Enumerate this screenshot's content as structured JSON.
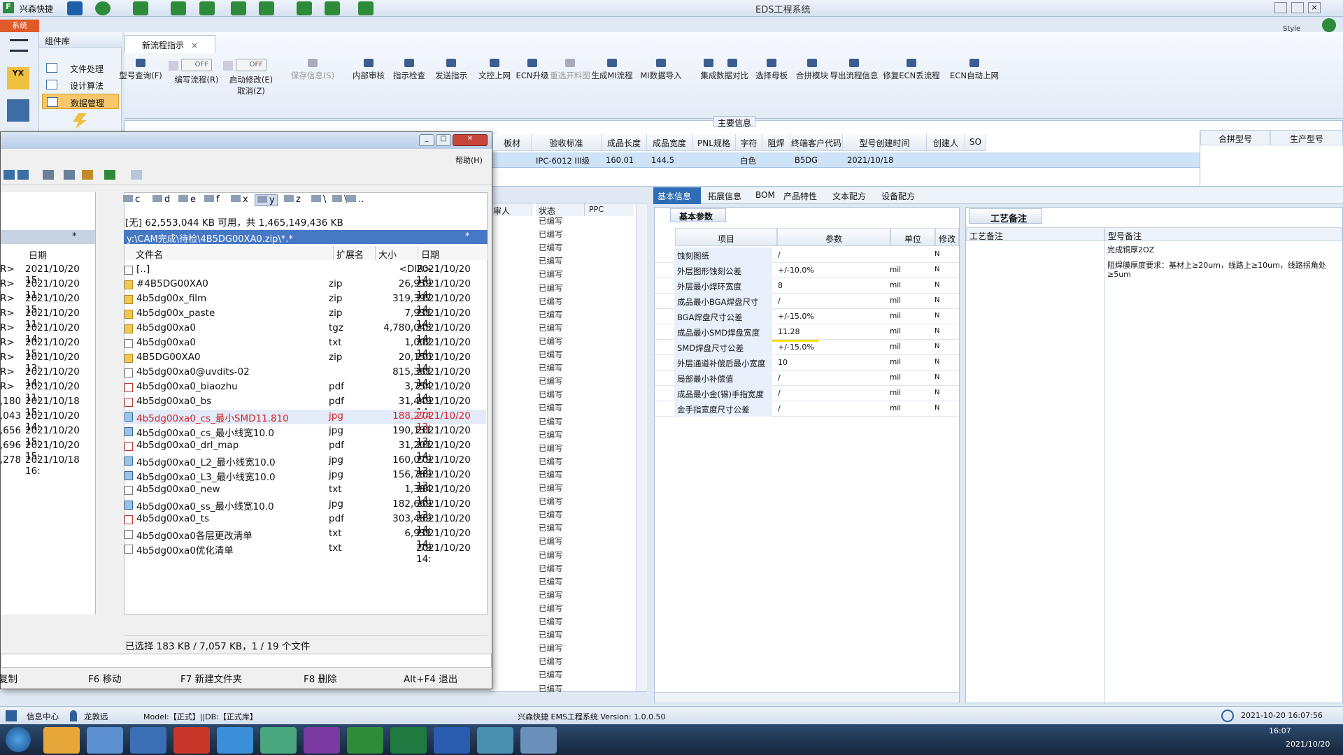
{
  "app": {
    "name": "兴森快捷",
    "title": "EDS工程系统",
    "style_label": "Style"
  },
  "sys_button": "系统",
  "component_lib": {
    "title": "组件库",
    "items": [
      "文件处理",
      "设计算法",
      "数据管理"
    ]
  },
  "flow_tab": "新流程指示",
  "ribbon": {
    "buttons": [
      {
        "label": "型号查询(F)",
        "x": 0
      },
      {
        "label": "编写流程(R)",
        "x": 1,
        "toggle": "OFF"
      },
      {
        "label": "启动修改(E)",
        "x": 2,
        "toggle": "OFF",
        "sub": "取消(Z)"
      },
      {
        "label": "保存信息(S)",
        "x": 3,
        "disabled": true
      },
      {
        "label": "内部审核",
        "x": 4
      },
      {
        "label": "指示检查",
        "x": 5
      },
      {
        "label": "发送指示",
        "x": 6
      },
      {
        "label": "文控上网",
        "x": 7
      },
      {
        "label": "ECN升级",
        "x": 8
      },
      {
        "label": "重选开料图",
        "x": 9,
        "disabled": true
      },
      {
        "label": "生成MI流程",
        "x": 10
      },
      {
        "label": "MI数据导入",
        "x": 11
      },
      {
        "label": "集成",
        "x": 12
      },
      {
        "label": "数据对比",
        "x": 13
      },
      {
        "label": "选择母板",
        "x": 14
      },
      {
        "label": "合拼模块",
        "x": 15
      },
      {
        "label": "导出流程信息",
        "x": 16
      },
      {
        "label": "修复ECN丢流程",
        "x": 17
      },
      {
        "label": "ECN自动上网",
        "x": 18
      }
    ]
  },
  "main_info": {
    "title": "主要信息",
    "headers": [
      "板材",
      "验收标准",
      "成品长度",
      "成品宽度",
      "PNL规格",
      "字符",
      "阻焊",
      "终端客户代码",
      "型号创建时间",
      "创建人",
      "SO"
    ],
    "row": [
      "",
      "IPC-6012 III级",
      "160.01",
      "144.5",
      "",
      "白色",
      "",
      "B5DG",
      "2021/10/18",
      "",
      ""
    ],
    "side_headers": [
      "合拼型号",
      "生产型号"
    ]
  },
  "status_list": {
    "headers": [
      "审人",
      "状态",
      "PPC"
    ],
    "value": "已编写",
    "count": 36
  },
  "detail_tabs": [
    "基本信息",
    "拓展信息",
    "BOM",
    "产品特性",
    "文本配方",
    "设备配方"
  ],
  "basic_params": {
    "title": "基本参数",
    "headers": [
      "项目",
      "参数",
      "单位",
      "修改"
    ],
    "rows": [
      {
        "k": "蚀刻图纸",
        "v": "/",
        "u": "",
        "n": "N"
      },
      {
        "k": "外层图形蚀刻公差",
        "v": "+/-10.0%",
        "u": "mil",
        "n": "N"
      },
      {
        "k": "外层最小焊环宽度",
        "v": "8",
        "u": "mil",
        "n": "N"
      },
      {
        "k": "成品最小BGA焊盘尺寸",
        "v": "/",
        "u": "mil",
        "n": "N"
      },
      {
        "k": "BGA焊盘尺寸公差",
        "v": "+/-15.0%",
        "u": "mil",
        "n": "N"
      },
      {
        "k": "成品最小SMD焊盘宽度",
        "v": "11.28",
        "u": "mil",
        "n": "N"
      },
      {
        "k": "SMD焊盘尺寸公差",
        "v": "+/-15.0%",
        "u": "mil",
        "n": "N"
      },
      {
        "k": "外层通道补偿后最小宽度",
        "v": "10",
        "u": "mil",
        "n": "N"
      },
      {
        "k": "局部最小补偿值",
        "v": "/",
        "u": "mil",
        "n": "N"
      },
      {
        "k": "成品最小金(锡)手指宽度",
        "v": "/",
        "u": "mil",
        "n": "N"
      },
      {
        "k": "金手指宽度尺寸公差",
        "v": "/",
        "u": "mil",
        "n": "N"
      }
    ]
  },
  "craft": {
    "title": "工艺备注",
    "col1": "工艺备注",
    "col2": "型号备注",
    "note1": "完成铜厚2OZ",
    "note2": "阻焊膜厚度要求：基材上≥20um，线路上≥10um，线路拐角处≥5um"
  },
  "explorer": {
    "menu_help": "帮助(H)",
    "drives": [
      "c",
      "d",
      "e",
      "f",
      "x",
      "y",
      "z",
      "\\",
      "\\",
      ".."
    ],
    "free_info": "[无] 62,553,044 KB 可用，共 1,465,149,436 KB",
    "path": "y:\\CAM完成\\待检\\4B5DG00XA0.zip\\*.*",
    "filter": "*",
    "headers": [
      "文件名",
      "扩展名",
      "大小",
      "日期"
    ],
    "left_header": "日期",
    "left_rows": [
      {
        "a": "R>",
        "b": "2021/10/20 15:"
      },
      {
        "a": "R>",
        "b": "2021/10/20 11:"
      },
      {
        "a": "R>",
        "b": "2021/10/20 15:"
      },
      {
        "a": "R>",
        "b": "2021/10/20 11:"
      },
      {
        "a": "R>",
        "b": "2021/10/20 14:"
      },
      {
        "a": "R>",
        "b": "2021/10/20 15:"
      },
      {
        "a": "R>",
        "b": "2021/10/20 13:"
      },
      {
        "a": "R>",
        "b": "2021/10/20 14:"
      },
      {
        "a": "R>",
        "b": "2021/10/20 11:"
      },
      {
        "a": ",180",
        "b": "2021/10/18 15:"
      },
      {
        "a": ",043",
        "b": "2021/10/20 14:"
      },
      {
        "a": ",656",
        "b": "2021/10/20 15:"
      },
      {
        "a": ",696",
        "b": "2021/10/20 15:"
      },
      {
        "a": ",278",
        "b": "2021/10/18 16:"
      }
    ],
    "files": [
      {
        "name": "[..]",
        "ext": "",
        "size": "<DIR>",
        "date": "2021/10/20 14:",
        "t": "up"
      },
      {
        "name": "#4B5DG00XA0",
        "ext": "zip",
        "size": "26,939",
        "date": "2021/10/20 14:",
        "t": "zip"
      },
      {
        "name": "4b5dg00x_film",
        "ext": "zip",
        "size": "319,397",
        "date": "2021/10/20 14:",
        "t": "zip"
      },
      {
        "name": "4b5dg00x_paste",
        "ext": "zip",
        "size": "7,931",
        "date": "2021/10/20 14:",
        "t": "zip"
      },
      {
        "name": "4b5dg00xa0",
        "ext": "tgz",
        "size": "4,780,043",
        "date": "2021/10/20 14:",
        "t": "zip"
      },
      {
        "name": "4b5dg00xa0",
        "ext": "txt",
        "size": "1,002",
        "date": "2021/10/20 14:",
        "t": "txt"
      },
      {
        "name": "4B5DG00XA0",
        "ext": "zip",
        "size": "20,150",
        "date": "2021/10/20 14:",
        "t": "zip"
      },
      {
        "name": "4b5dg00xa0@uvdits-02",
        "ext": "",
        "size": "815,361",
        "date": "2021/10/20 14:",
        "t": "txt"
      },
      {
        "name": "4b5dg00xa0_biaozhu",
        "ext": "pdf",
        "size": "3,754",
        "date": "2021/10/20 14:",
        "t": "pdf"
      },
      {
        "name": "4b5dg00xa0_bs",
        "ext": "pdf",
        "size": "31,449",
        "date": "2021/10/20 14:",
        "t": "pdf"
      },
      {
        "name": "4b5dg00xa0_cs_最小SMD11.810",
        "ext": "jpg",
        "size": "188,274",
        "date": "2021/10/20 13:",
        "t": "jpg",
        "sel": true
      },
      {
        "name": "4b5dg00xa0_cs_最小线宽10.0",
        "ext": "jpg",
        "size": "190,131",
        "date": "2021/10/20 13:",
        "t": "jpg"
      },
      {
        "name": "4b5dg00xa0_drl_map",
        "ext": "pdf",
        "size": "31,201",
        "date": "2021/10/20 14:",
        "t": "pdf"
      },
      {
        "name": "4b5dg00xa0_L2_最小线宽10.0",
        "ext": "jpg",
        "size": "160,079",
        "date": "2021/10/20 13:",
        "t": "jpg"
      },
      {
        "name": "4b5dg00xa0_L3_最小线宽10.0",
        "ext": "jpg",
        "size": "156,789",
        "date": "2021/10/20 13:",
        "t": "jpg"
      },
      {
        "name": "4b5dg00xa0_new",
        "ext": "txt",
        "size": "1,384",
        "date": "2021/10/20 14:",
        "t": "txt"
      },
      {
        "name": "4b5dg00xa0_ss_最小线宽10.0",
        "ext": "jpg",
        "size": "182,669",
        "date": "2021/10/20 13:",
        "t": "jpg"
      },
      {
        "name": "4b5dg00xa0_ts",
        "ext": "pdf",
        "size": "303,489",
        "date": "2021/10/20 14:",
        "t": "pdf"
      },
      {
        "name": "4b5dg00xa0各层更改清单",
        "ext": "txt",
        "size": "6,931",
        "date": "2021/10/20 14:",
        "t": "txt"
      },
      {
        "name": "4b5dg00xa0优化清单",
        "ext": "txt",
        "size": "79",
        "date": "2021/10/20 14:",
        "t": "txt"
      }
    ],
    "selection_status": "已选择 183 KB / 7,057 KB，1 / 19 个文件",
    "fkeys": [
      "复制",
      "F6 移动",
      "F7 新建文件夹",
      "F8 删除",
      "Alt+F4 退出"
    ]
  },
  "statusbar": {
    "info": "信息中心",
    "user": "龙敦远",
    "model": "Model:【正式】||DB:【正式库】",
    "version": "兴森快捷  EMS工程系统  Version: 1.0.0.50",
    "datetime": "2021-10-20 16:07:56"
  },
  "taskbar": {
    "time": "16:07",
    "date": "2021/10/20"
  }
}
